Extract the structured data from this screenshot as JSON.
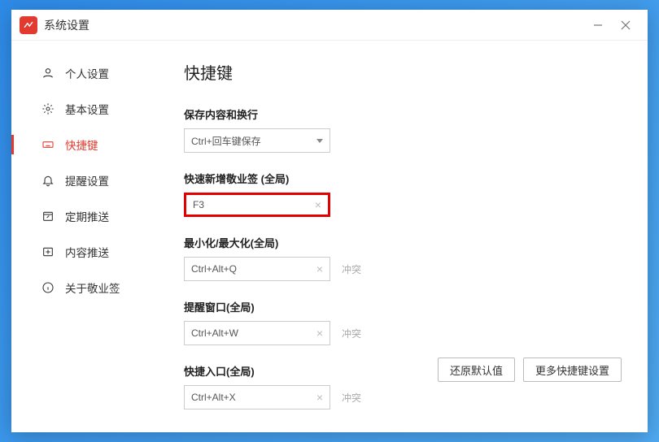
{
  "titlebar": {
    "title": "系统设置"
  },
  "sidebar": {
    "items": [
      {
        "label": "个人设置"
      },
      {
        "label": "基本设置"
      },
      {
        "label": "快捷键"
      },
      {
        "label": "提醒设置"
      },
      {
        "label": "定期推送"
      },
      {
        "label": "内容推送"
      },
      {
        "label": "关于敬业签"
      }
    ],
    "active_index": 2
  },
  "content": {
    "title": "快捷键",
    "fields": {
      "save": {
        "label": "保存内容和换行",
        "value": "Ctrl+回车键保存"
      },
      "quick_add": {
        "label": "快速新增敬业签 (全局)",
        "value": "F3"
      },
      "minmax": {
        "label": "最小化/最大化(全局)",
        "value": "Ctrl+Alt+Q",
        "conflict": "冲突"
      },
      "remind": {
        "label": "提醒窗口(全局)",
        "value": "Ctrl+Alt+W",
        "conflict": "冲突"
      },
      "entry": {
        "label": "快捷入口(全局)",
        "value": "Ctrl+Alt+X",
        "conflict": "冲突"
      }
    },
    "buttons": {
      "restore": "还原默认值",
      "more": "更多快捷键设置"
    }
  }
}
